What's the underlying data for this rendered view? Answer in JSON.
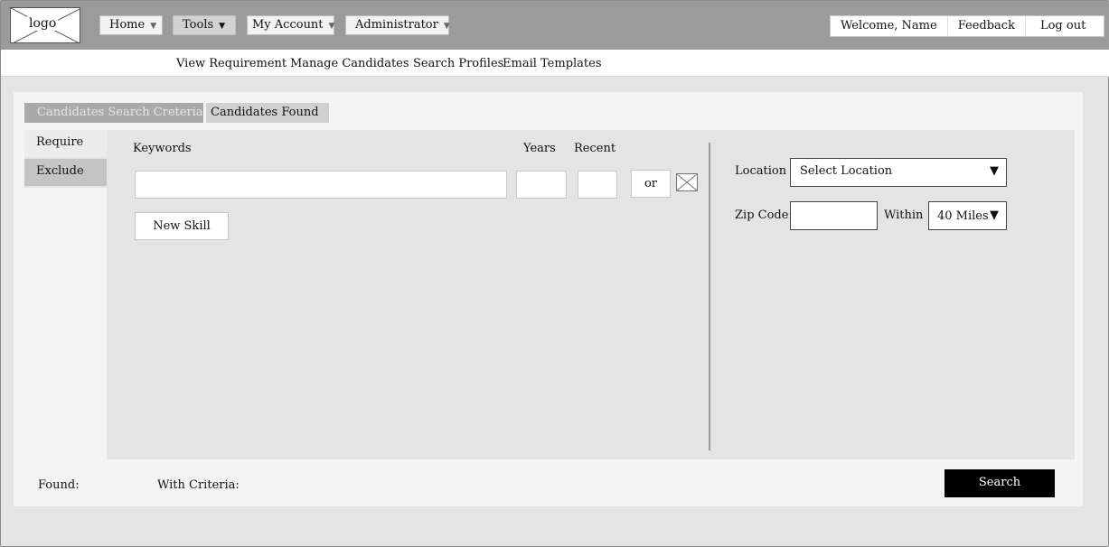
{
  "header": {
    "logo_text": "logo",
    "nav": [
      {
        "label": "Home"
      },
      {
        "label": "Tools"
      },
      {
        "label": "My Account"
      },
      {
        "label": "Administrator"
      }
    ],
    "welcome": "Welcome, Name",
    "feedback": "Feedback",
    "logout": "Log out"
  },
  "subnav": {
    "items": [
      "View Requirement",
      "Manage Candidates",
      "Search Profiles",
      "Email Templates"
    ]
  },
  "tabs": {
    "criteria": "Candidates Search Creteria",
    "found": "Candidates Found"
  },
  "side_tabs": {
    "require": "Require",
    "exclude": "Exclude"
  },
  "skills": {
    "keywords_label": "Keywords",
    "years_label": "Years",
    "recent_label": "Recent",
    "keywords_value": "",
    "years_value": "",
    "recent_value": "",
    "or_label": "or",
    "new_skill_label": "New Skill"
  },
  "location": {
    "location_label": "Location",
    "location_value": "Select Location",
    "zip_label": "Zip Code:",
    "zip_value": "",
    "within_label": "Within",
    "within_value": "40 Miles"
  },
  "footer": {
    "found_label": "Found:",
    "criteria_label": "With Criteria:",
    "search_label": "Search"
  },
  "icons": {
    "logo": "logo-placeholder-icon",
    "remove": "close-box-icon",
    "dropdown": "caret-down-icon"
  }
}
